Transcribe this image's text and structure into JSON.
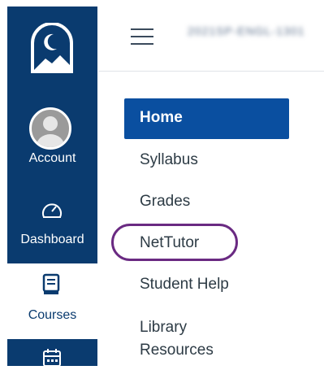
{
  "global_nav": {
    "logo_icon": "moon-mountain-logo-icon",
    "items": [
      {
        "label": "Account",
        "icon": "account-avatar-icon"
      },
      {
        "label": "Dashboard",
        "icon": "dashboard-gauge-icon"
      },
      {
        "label": "Courses",
        "icon": "courses-book-icon"
      },
      {
        "label": "",
        "icon": "calendar-icon"
      }
    ],
    "colors": {
      "nav_background": "#0a3b6f",
      "active_background": "#ffffff",
      "active_text": "#0a3b6f"
    }
  },
  "header": {
    "menu_icon": "hamburger-menu-icon",
    "breadcrumb": "2021SP-ENGL-1301"
  },
  "course_nav": {
    "items": [
      {
        "label": "Home",
        "active": true
      },
      {
        "label": "Syllabus"
      },
      {
        "label": "Grades"
      },
      {
        "label": "NetTutor",
        "highlighted": true
      },
      {
        "label": "Student Help"
      },
      {
        "label": "Library Resources",
        "lines": [
          "Library",
          "Resources"
        ]
      }
    ],
    "colors": {
      "active_background": "#0a4fa0",
      "highlight_circle": "#6a2a82"
    }
  }
}
